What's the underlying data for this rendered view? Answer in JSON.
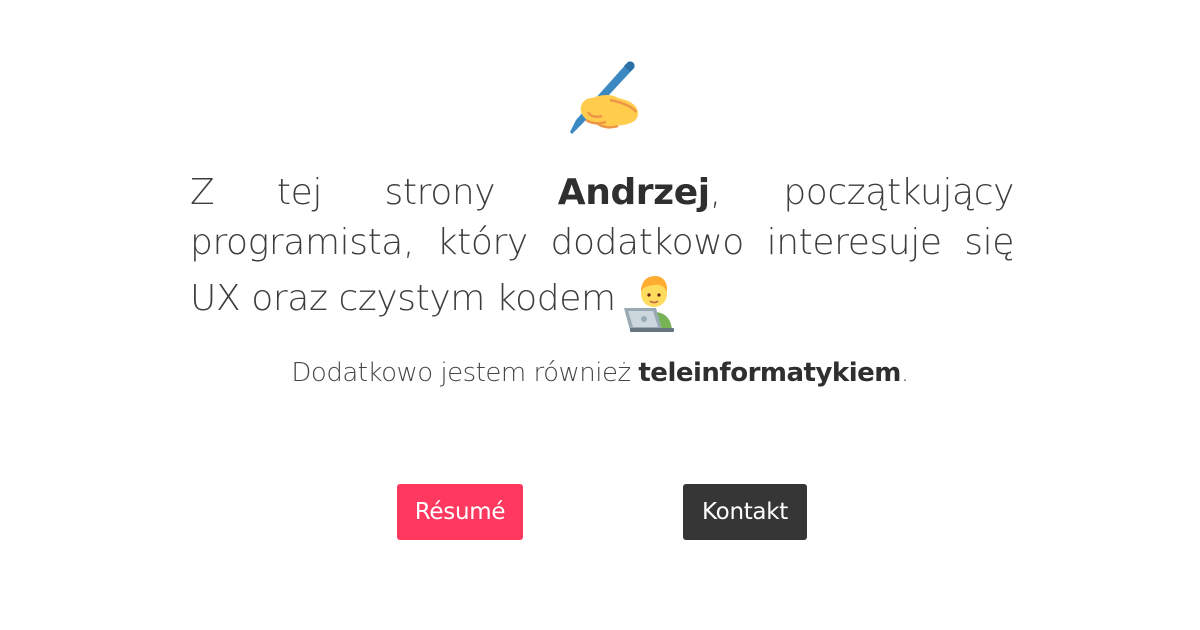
{
  "hero": {
    "icon": "writing-hand-icon"
  },
  "intro": {
    "part1": "Z tej strony ",
    "name": "Andrzej",
    "part2": ", początkujący programista, który dodatkowo interesuje się UX oraz czystym kodem",
    "icon": "technologist-icon"
  },
  "subline": {
    "part1": "Dodatkowo jestem również ",
    "bold": "teleinformatykiem",
    "part2": "."
  },
  "buttons": {
    "resume_label": "Résumé",
    "contact_label": "Kontakt"
  },
  "colors": {
    "resume_button": "#ff3860",
    "contact_button": "#363636",
    "text": "#3d3d3d"
  }
}
